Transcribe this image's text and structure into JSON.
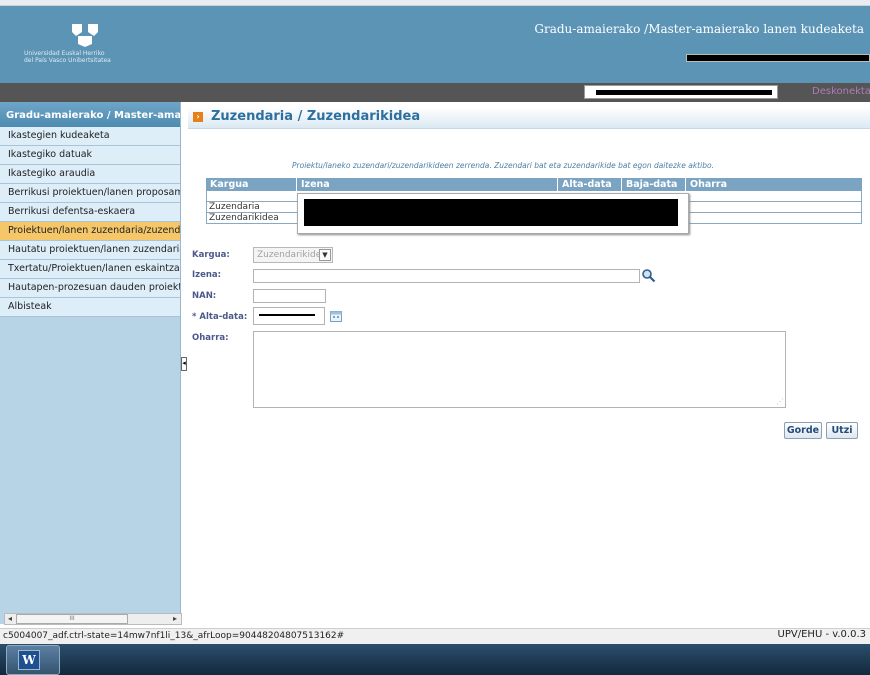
{
  "header": {
    "logo_line1": "Universidad    Euskal Herriko",
    "logo_line2": "del País Vasco    Unibertsitatea",
    "title": "Gradu-amaierako /Master-amaierako lanen kudeaketa",
    "logout": "Deskonektatzen"
  },
  "sidebar": {
    "title": "Gradu-amaierako / Master-amaierako",
    "items": [
      {
        "label": "Ikastegien kudeaketa",
        "active": false
      },
      {
        "label": "Ikastegiko datuak",
        "active": false
      },
      {
        "label": "Ikastegiko araudia",
        "active": false
      },
      {
        "label": "Berrikusi proiektuen/lanen proposamenak",
        "active": false
      },
      {
        "label": "Berrikusi defentsa-eskaera",
        "active": false
      },
      {
        "label": "Proiektuen/lanen zuzendaria/zuzendarikidea",
        "active": true
      },
      {
        "label": "Hautatu proiektuen/lanen zuzendariak",
        "active": false
      },
      {
        "label": "Txertatu/Proiektuen/lanen eskaintza",
        "active": false
      },
      {
        "label": "Hautapen-prozesuan dauden proiektuak",
        "active": false
      },
      {
        "label": "Albisteak",
        "active": false
      }
    ],
    "scroll_thumb_label": "III"
  },
  "main": {
    "title": "Zuzendaria / Zuzendarikidea",
    "info": "Proiektu/laneko zuzendari/zuzendarikideen zerrenda. Zuzendari bat eta zuzendarikide bat egon daitezke aktibo.",
    "table": {
      "columns": [
        "Kargua",
        "Izena",
        "Alta-data",
        "Baja-data",
        "Oharra"
      ],
      "rows": [
        [
          "",
          "",
          "",
          "",
          ""
        ],
        [
          "Zuzendaria",
          "",
          "",
          "",
          ""
        ],
        [
          "Zuzendarikidea",
          "",
          "",
          "",
          ""
        ]
      ]
    },
    "form": {
      "kargua_label": "Kargua:",
      "kargua_value": "Zuzendarikidea",
      "izena_label": "Izena:",
      "izena_value": "",
      "nan_label": "NAN:",
      "nan_value": "",
      "alta_label": "* Alta-data:",
      "oharra_label": "Oharra:",
      "oharra_value": ""
    },
    "buttons": {
      "save": "Gorde",
      "cancel": "Utzi"
    }
  },
  "status": {
    "url": "c5004007_adf.ctrl-state=14mw7nf1li_13&_afrLoop=90448204807513162#",
    "version": "UPV/EHU - v.0.0.3"
  },
  "colors": {
    "header_bg": "#5c94b6",
    "sidebar_bg": "#b7d3e6",
    "active_item": "#f6c768",
    "accent_title": "#2d6f9e"
  }
}
